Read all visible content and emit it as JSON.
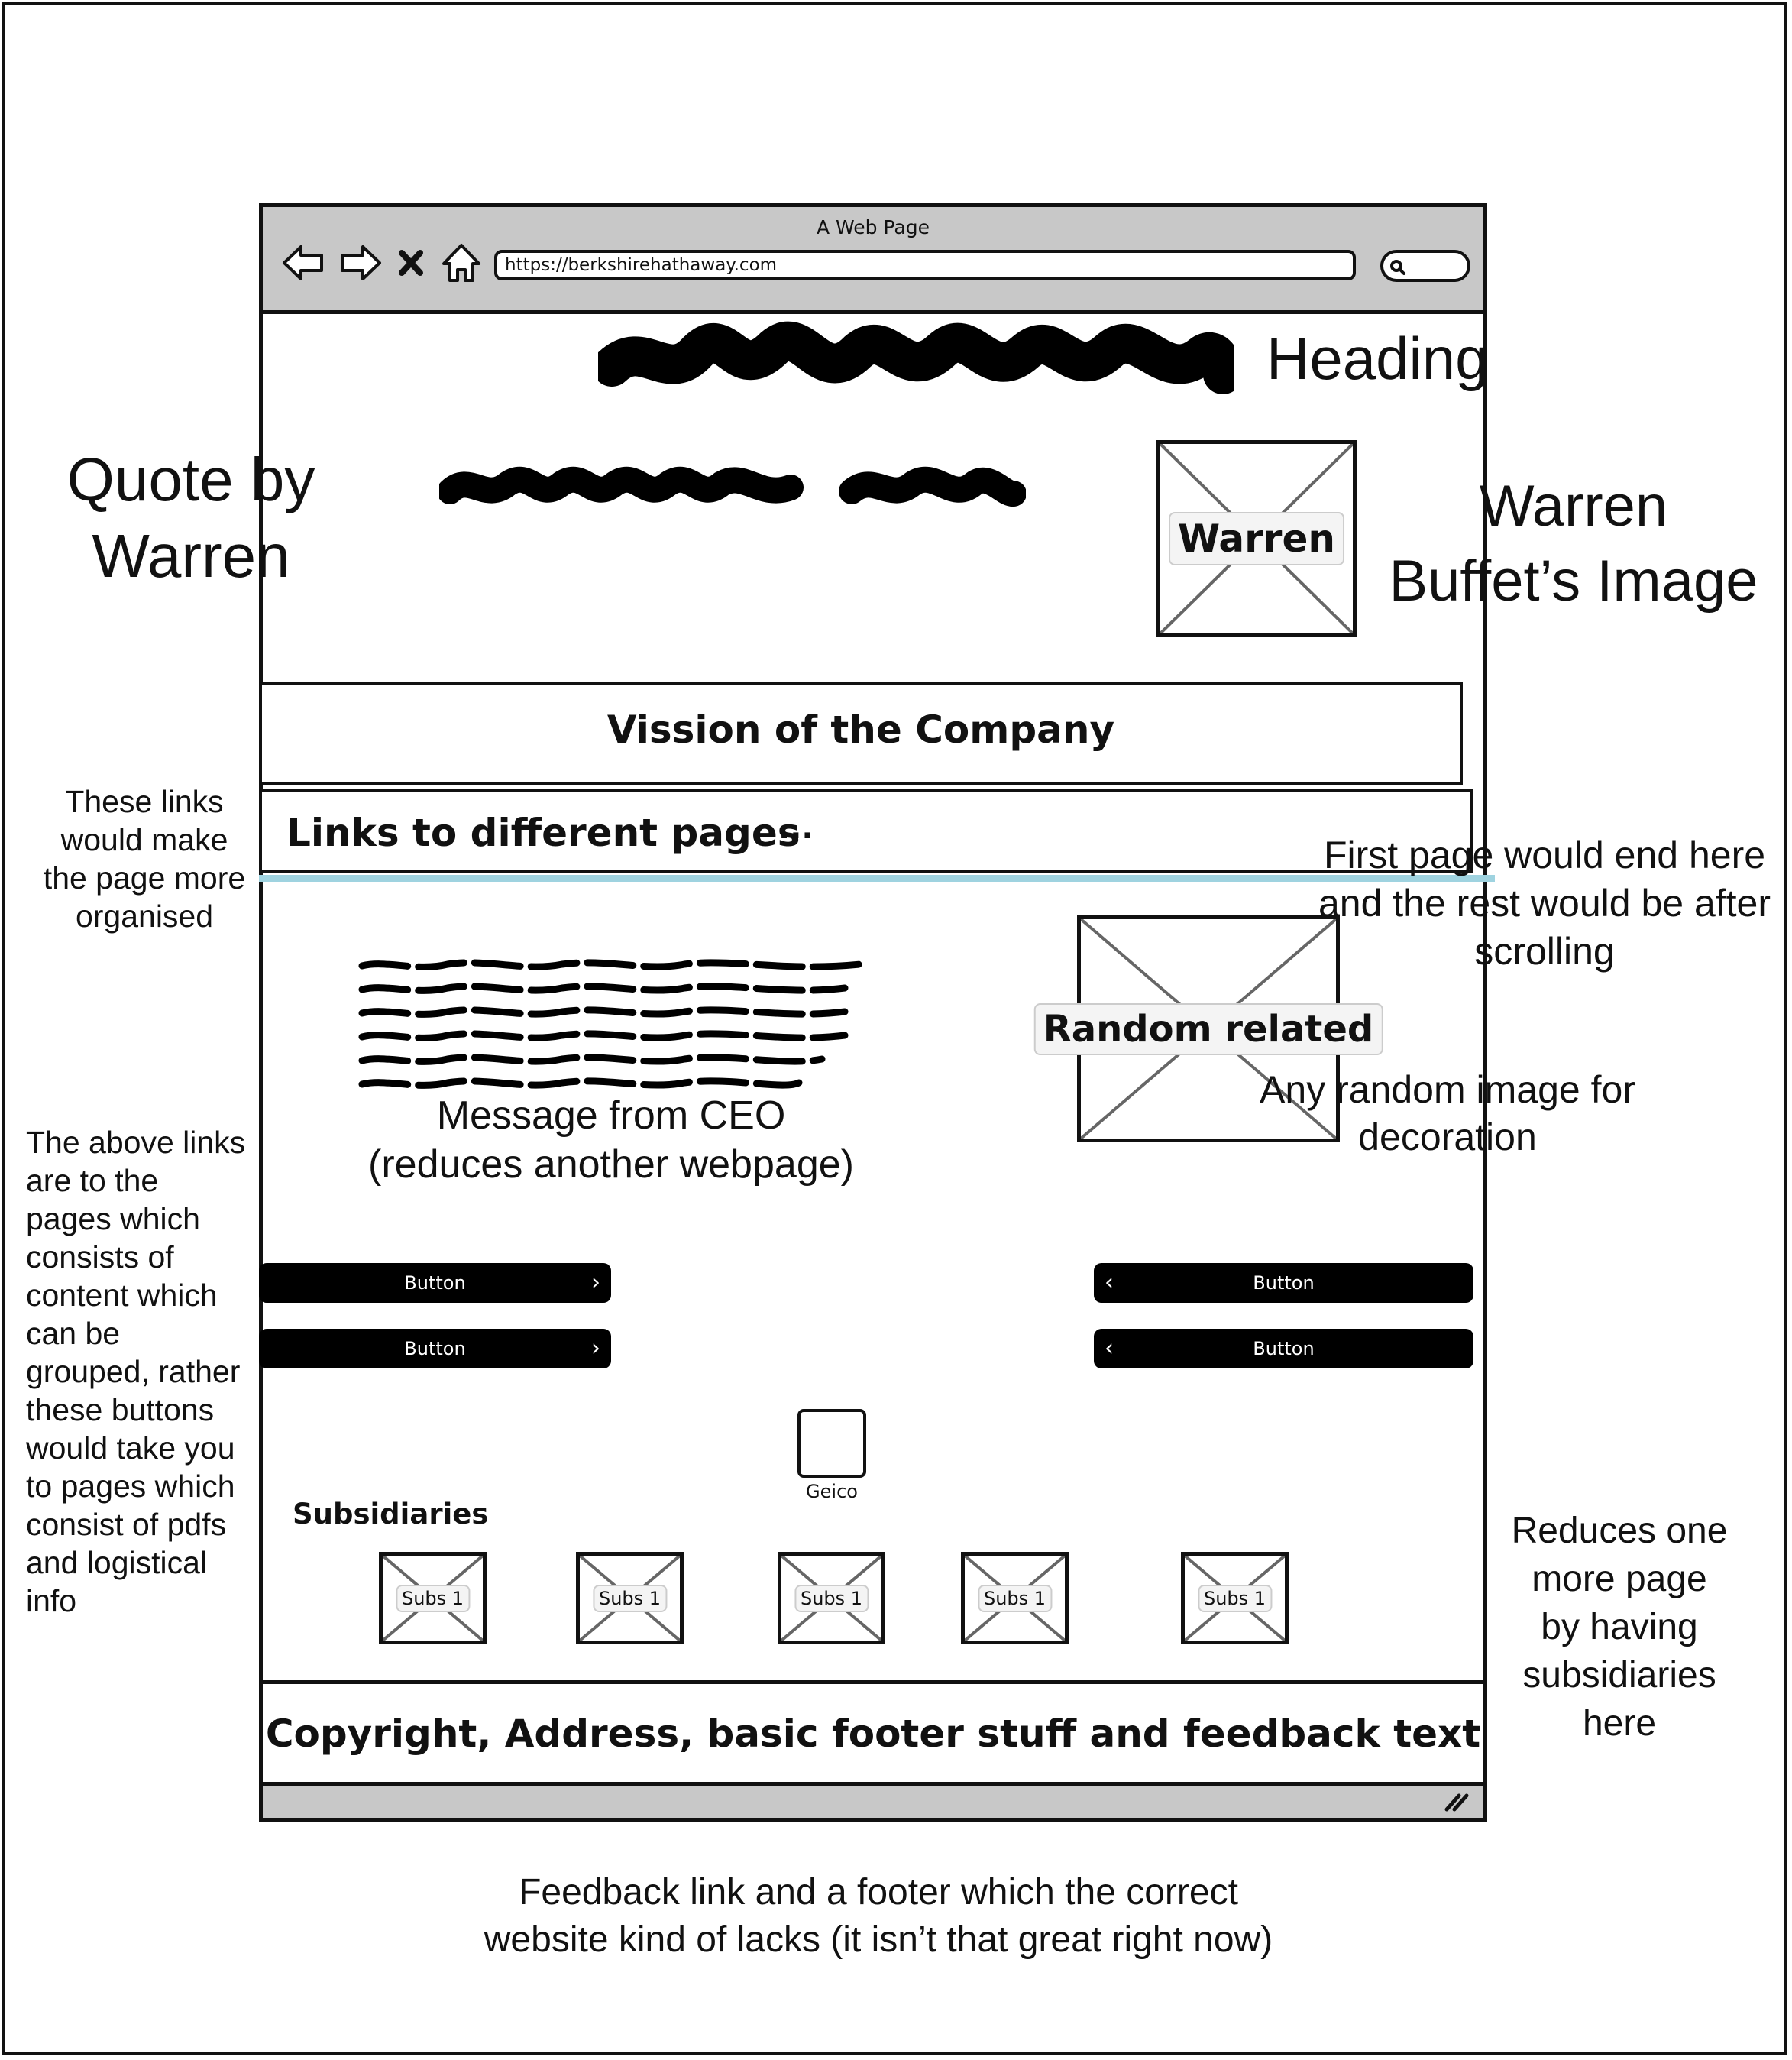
{
  "window": {
    "title": "A Web Page",
    "url": "https://berkshirehathaway.com"
  },
  "icons": {
    "back": "back-arrow-icon",
    "forward": "forward-arrow-icon",
    "stop": "close-icon",
    "home": "home-icon",
    "search": "search-icon",
    "resize": "resize-grip-icon"
  },
  "hero": {
    "warren_image_label": "Warren"
  },
  "vision": {
    "label": "Vission of the Company"
  },
  "links_bar": {
    "label": "Links to different pages",
    "more": "..."
  },
  "ceo": {
    "caption_line1": "Message from CEO",
    "caption_line2": "(reduces another webpage)"
  },
  "random_image": {
    "label": "Random related"
  },
  "buttons": {
    "left": [
      {
        "label": "Button"
      },
      {
        "label": "Button"
      }
    ],
    "right": [
      {
        "label": "Button"
      },
      {
        "label": "Button"
      }
    ]
  },
  "subsidiaries": {
    "title": "Subsidiaries",
    "featured": {
      "label": "Geico"
    },
    "items": [
      {
        "label": "Subs 1"
      },
      {
        "label": "Subs 1"
      },
      {
        "label": "Subs 1"
      },
      {
        "label": "Subs 1"
      },
      {
        "label": "Subs 1"
      }
    ]
  },
  "footer": {
    "label": "Copyright, Address, basic footer stuff and feedback text"
  },
  "annotations": {
    "heading": "Heading",
    "quote_line1": "Quote by",
    "quote_line2": "Warren",
    "warren_img_line1": "Warren",
    "warren_img_line2": "Buffet’s Image",
    "links_note": [
      "These links",
      "would make",
      "the page more",
      "organised"
    ],
    "first_page_note": [
      "First page would end here",
      "and the rest would be after",
      "scrolling"
    ],
    "decoration_note": [
      "Any random image for",
      "decoration"
    ],
    "buttons_note": [
      "The above links",
      "are to the",
      "pages which",
      "consists of",
      "content which",
      "can be",
      "grouped, rather",
      "these buttons",
      "would take you",
      "to pages which",
      "consist of pdfs",
      "and logistical",
      "info"
    ],
    "subs_note": [
      "Reduces one",
      "more page",
      "by having",
      "subsidiaries",
      "here"
    ],
    "footer_note": [
      "Feedback link and a footer which the correct",
      "website kind of lacks (it isn’t that great right now)"
    ]
  },
  "colors": {
    "fold_line": "#9fd3e0",
    "chrome": "#c8c8c8",
    "button": "#000000"
  }
}
